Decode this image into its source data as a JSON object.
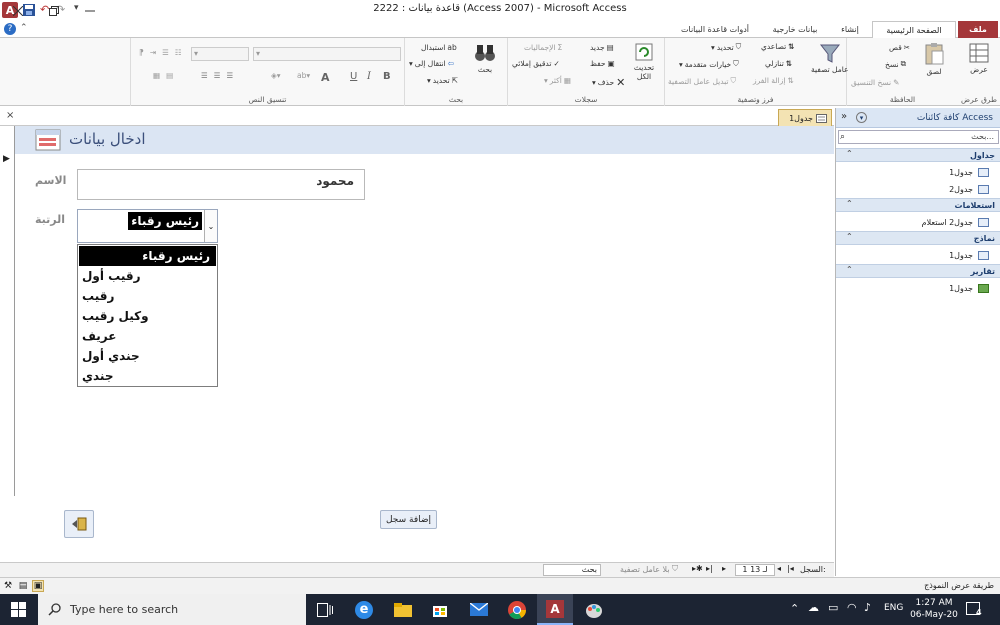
{
  "window": {
    "title": "2222 : قاعدة بيانات (Access 2007) - Microsoft Access"
  },
  "ribbon_tabs": {
    "file": "ملف",
    "home": "الصفحة الرئيسية",
    "create": "إنشاء",
    "external": "بيانات خارجية",
    "dbtools": "أدوات قاعدة البيانات"
  },
  "ribbon": {
    "views": {
      "view": "عرض",
      "group": "طرق عرض"
    },
    "clipboard": {
      "paste": "لصق",
      "cut": "قص",
      "copy": "نسخ",
      "format_painter": "نسخ التنسيق",
      "group": "الحافظة"
    },
    "sort": {
      "filter": "عامل تصفية",
      "ascending": "تصاعدي",
      "descending": "تنازلي",
      "remove_sort": "إزالة الفرز",
      "selection": "تحديد",
      "advanced": "خيارات متقدمة",
      "toggle_filter": "تبديل عامل التصفية",
      "group": "فرز وتصفية"
    },
    "records": {
      "refresh": "تحديث الكل",
      "new": "جديد",
      "save": "حفظ",
      "delete": "حذف",
      "totals": "الإجماليات",
      "spelling": "تدقيق إملائي",
      "more": "أكثر",
      "group": "سجلات"
    },
    "find": {
      "find": "بحث",
      "replace": "استبدال",
      "goto": "انتقال إلى",
      "select": "تحديد",
      "group": "بحث"
    },
    "text": {
      "group": "تنسيق النص",
      "bold": "B",
      "italic": "I",
      "underline": "U"
    }
  },
  "nav_pane": {
    "title": "كافة كائنات Access",
    "search_placeholder": "بحث...",
    "sections": [
      {
        "label": "جداول",
        "items": [
          "جدول1",
          "جدول2"
        ]
      },
      {
        "label": "استعلامات",
        "items": [
          "جدول2 استعلام"
        ]
      },
      {
        "label": "نماذج",
        "items": [
          "جدول1"
        ]
      },
      {
        "label": "تقارير",
        "items": [
          "جدول1"
        ]
      }
    ]
  },
  "document_tab": "جدول1",
  "form": {
    "title": "ادخال بيانات",
    "name_label": "الاسم",
    "name_value": "محمود",
    "rank_label": "الرتبة",
    "rank_value": "رئيس رقباء",
    "rank_options": [
      "رئيس رقباء",
      "رقيب أول",
      "رقيب",
      "وكيل رقيب",
      "عريف",
      "جندي أول",
      "جندي"
    ],
    "add_record_button": "إضافة سجل"
  },
  "record_nav": {
    "label": "السجل:",
    "position": "1 لـ 13",
    "filter_status": "بلا عامل تصفية",
    "search": "بحث"
  },
  "status_bar": {
    "view_text": "طريقة عرض النموذج"
  },
  "taskbar": {
    "search_placeholder": "Type here to search",
    "lang": "ENG",
    "time": "1:27 AM",
    "date": "06-May-20",
    "notification_count": "4"
  },
  "colors": {
    "file_tab": "#a4373a",
    "form_header": "#dbe5f3",
    "nav_header": "#dbe6f4",
    "taskbar": "#1c2433"
  }
}
